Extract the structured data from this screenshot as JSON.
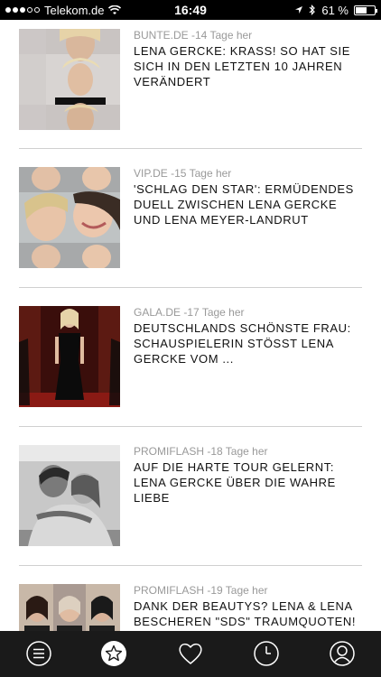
{
  "status": {
    "carrier": "Telekom.de",
    "time": "16:49",
    "battery_percent": "61 %",
    "battery_level": 0.61,
    "signal_bars_filled": 3,
    "signal_bars_total": 5
  },
  "articles": [
    {
      "source": "BUNTE.DE",
      "age": "-14 Tage her",
      "meta": "BUNTE.DE -14 Tage her",
      "title": "LENA GERCKE: KRASS! SO HAT SIE SICH IN DEN LETZTEN 10 JAHREN VERÄNDERT"
    },
    {
      "source": "VIP.DE",
      "age": "-15 Tage her",
      "meta": "VIP.DE -15 Tage her",
      "title": "'SCHLAG DEN STAR': ERMÜDENDES DUELL ZWISCHEN LENA GERCKE UND LENA MEYER-LANDRUT"
    },
    {
      "source": "GALA.DE",
      "age": "-17 Tage her",
      "meta": "GALA.DE -17 Tage her",
      "title": "DEUTSCHLANDS SCHÖNSTE FRAU: SCHAUSPIELERIN STÖSST LENA GERCKE VOM ..."
    },
    {
      "source": "PROMIFLASH",
      "age": "-18 Tage her",
      "meta": "PROMIFLASH -18 Tage her",
      "title": "AUF DIE HARTE TOUR GELERNT: LENA GERCKE ÜBER DIE WAHRE LIEBE"
    },
    {
      "source": "PROMIFLASH",
      "age": "-19 Tage her",
      "meta": "PROMIFLASH -19 Tage her",
      "title": "DANK DER BEAUTYS? LENA & LENA BESCHEREN \"SDS\" TRAUMQUOTEN!"
    }
  ],
  "tabbar": {
    "icons": [
      "menu-icon",
      "star-icon",
      "heart-icon",
      "clock-icon",
      "profile-icon"
    ],
    "active": "star-icon"
  }
}
